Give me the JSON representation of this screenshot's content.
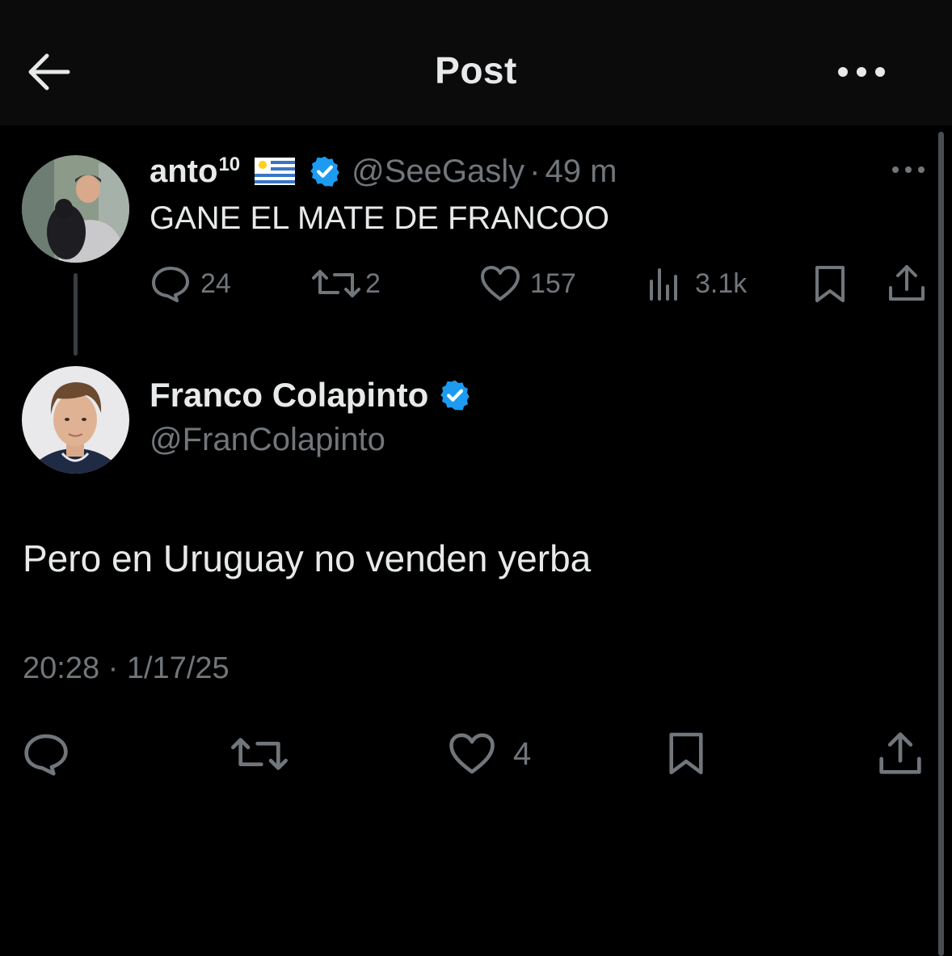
{
  "header": {
    "title": "Post"
  },
  "parent_post": {
    "display_name": "anto",
    "name_superscript": "10",
    "flag_icon": "uruguay-flag-icon",
    "handle": "@SeeGasly",
    "separator": "·",
    "time": "49 m",
    "text": "GANE EL MATE DE FRANCOO",
    "stats": {
      "replies": "24",
      "reposts": "2",
      "likes": "157",
      "views": "3.1k"
    }
  },
  "main_post": {
    "display_name": "Franco Colapinto",
    "handle": "@FranColapinto",
    "text": "Pero en Uruguay no venden yerba",
    "timestamp": "20:28 · 1/17/25",
    "likes": "4"
  },
  "colors": {
    "background": "#000000",
    "text_primary": "#e7e9ea",
    "text_secondary": "#71767b",
    "verified": "#1d9bf0"
  }
}
